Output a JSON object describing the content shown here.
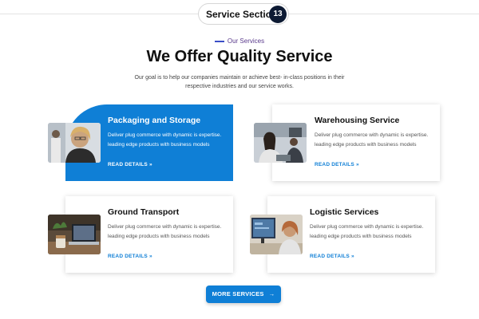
{
  "section_tag": {
    "label": "Service Section",
    "number": "13"
  },
  "eyebrow": "Our Services",
  "title": "We Offer Quality Service",
  "description": "Our goal is to help our companies maintain or achieve best- in-class positions in their respective industries and our service works.",
  "cards": [
    {
      "title": "Packaging and Storage",
      "text": "Deliver plug commerce with dynamic is expertise. leading edge products with business models",
      "link": "READ DETAILS",
      "link_icon": "»",
      "image": "woman-with-glasses-photo",
      "active": true
    },
    {
      "title": "Warehousing Service",
      "text": "Deliver plug commerce with dynamic is expertise. leading edge products with business models",
      "link": "READ DETAILS",
      "link_icon": "»",
      "image": "office-meeting-photo",
      "active": false
    },
    {
      "title": "Ground Transport",
      "text": "Deliver plug commerce with dynamic is expertise. leading edge products with business models",
      "link": "READ DETAILS",
      "link_icon": "»",
      "image": "laptop-coffee-photo",
      "active": false
    },
    {
      "title": "Logistic Services",
      "text": "Deliver plug commerce with dynamic is expertise. leading edge products with business models",
      "link": "READ DETAILS",
      "link_icon": "»",
      "image": "woman-at-monitor-photo",
      "active": false
    }
  ],
  "more_button": {
    "label": "MORE SERVICES",
    "icon": "→"
  },
  "colors": {
    "accent": "#0f7fd6",
    "badge": "#0d1a33",
    "eyebrow": "#5a3a8c"
  }
}
